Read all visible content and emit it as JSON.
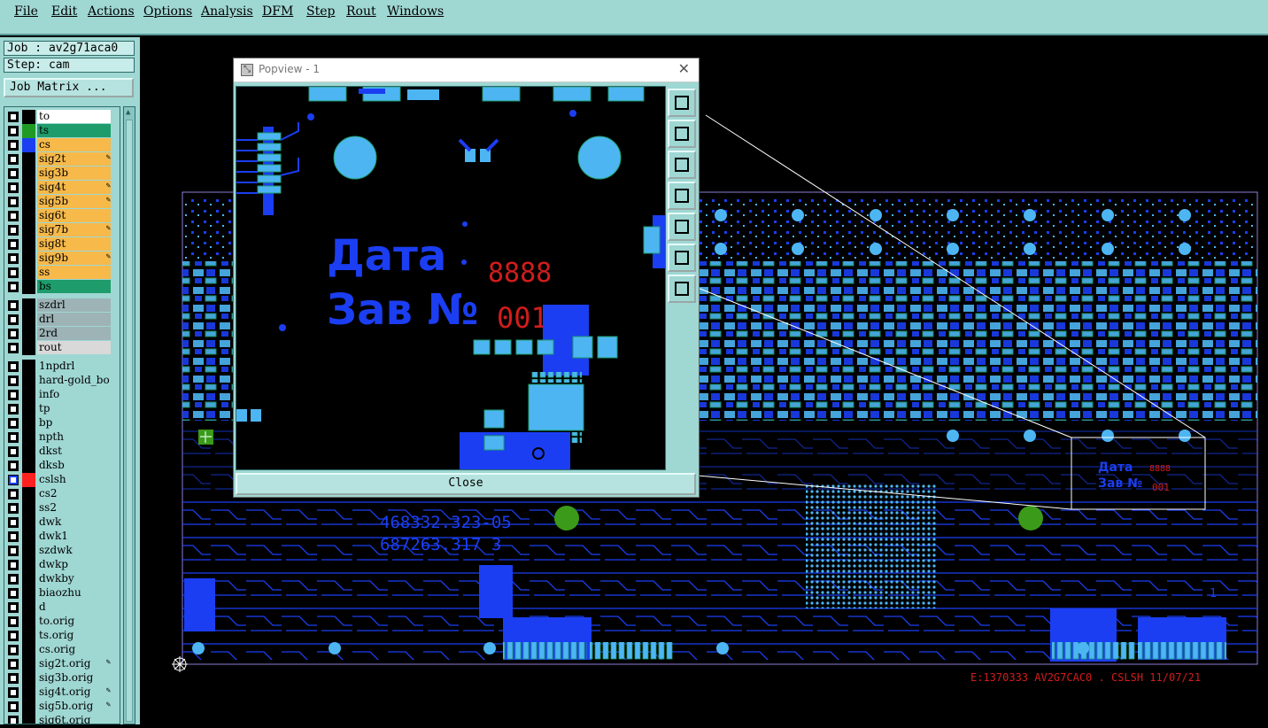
{
  "menu": [
    "File",
    "Edit",
    "Actions",
    "Options",
    "Analysis",
    "DFM",
    "Step",
    "Rout",
    "Windows"
  ],
  "job": {
    "label": "Job : av2g71aca0",
    "step": "Step: cam",
    "matrix_button": "Job Matrix ..."
  },
  "layers": [
    {
      "name": "to",
      "color": "#ffffff",
      "swatch": "#000000"
    },
    {
      "name": "ts",
      "color": "#1e9c6b",
      "swatch": "#1f9b25"
    },
    {
      "name": "cs",
      "color": "#f6b94a",
      "swatch": "#1b3ef2"
    },
    {
      "name": "sig2t",
      "color": "#f6b94a",
      "swatch": "#000000",
      "edit": true
    },
    {
      "name": "sig3b",
      "color": "#f6b94a",
      "swatch": "#000000"
    },
    {
      "name": "sig4t",
      "color": "#f6b94a",
      "swatch": "#000000",
      "edit": true
    },
    {
      "name": "sig5b",
      "color": "#f6b94a",
      "swatch": "#000000",
      "edit": true
    },
    {
      "name": "sig6t",
      "color": "#f6b94a",
      "swatch": "#000000"
    },
    {
      "name": "sig7b",
      "color": "#f6b94a",
      "swatch": "#000000",
      "edit": true
    },
    {
      "name": "sig8t",
      "color": "#f6b94a",
      "swatch": "#000000"
    },
    {
      "name": "sig9b",
      "color": "#f6b94a",
      "swatch": "#000000",
      "edit": true
    },
    {
      "name": "ss",
      "color": "#f6b94a",
      "swatch": "#000000"
    },
    {
      "name": "bs",
      "color": "#1e9c6b",
      "swatch": "#000000"
    },
    {
      "name": "szdrl",
      "color": "#9db3b6",
      "swatch": "#000000",
      "gap": true
    },
    {
      "name": "drl",
      "color": "#9db3b6",
      "swatch": "#000000"
    },
    {
      "name": "2rd",
      "color": "#9db3b6",
      "swatch": "#000000"
    },
    {
      "name": "rout",
      "color": "#d9d9d9",
      "swatch": "#000000"
    },
    {
      "name": "1npdrl",
      "color": "#9fd7d3",
      "swatch": "#000000",
      "gap": true
    },
    {
      "name": "hard-gold_bo",
      "color": "#9fd7d3",
      "swatch": "#000000"
    },
    {
      "name": "info",
      "color": "#9fd7d3",
      "swatch": "#000000"
    },
    {
      "name": "tp",
      "color": "#9fd7d3",
      "swatch": "#000000"
    },
    {
      "name": "bp",
      "color": "#9fd7d3",
      "swatch": "#000000"
    },
    {
      "name": "npth",
      "color": "#9fd7d3",
      "swatch": "#000000"
    },
    {
      "name": "dkst",
      "color": "#9fd7d3",
      "swatch": "#000000"
    },
    {
      "name": "dksb",
      "color": "#9fd7d3",
      "swatch": "#000000"
    },
    {
      "name": "cslsh",
      "color": "#9fd7d3",
      "swatch": "#ff2020",
      "active": true
    },
    {
      "name": "cs2",
      "color": "#9fd7d3",
      "swatch": "#000000"
    },
    {
      "name": "ss2",
      "color": "#9fd7d3",
      "swatch": "#000000"
    },
    {
      "name": "dwk",
      "color": "#9fd7d3",
      "swatch": "#000000"
    },
    {
      "name": "dwk1",
      "color": "#9fd7d3",
      "swatch": "#000000"
    },
    {
      "name": "szdwk",
      "color": "#9fd7d3",
      "swatch": "#000000"
    },
    {
      "name": "dwkp",
      "color": "#9fd7d3",
      "swatch": "#000000"
    },
    {
      "name": "dwkby",
      "color": "#9fd7d3",
      "swatch": "#000000"
    },
    {
      "name": "biaozhu",
      "color": "#9fd7d3",
      "swatch": "#000000"
    },
    {
      "name": "d",
      "color": "#9fd7d3",
      "swatch": "#000000"
    },
    {
      "name": "to.orig",
      "color": "#9fd7d3",
      "swatch": "#000000"
    },
    {
      "name": "ts.orig",
      "color": "#9fd7d3",
      "swatch": "#000000"
    },
    {
      "name": "cs.orig",
      "color": "#9fd7d3",
      "swatch": "#000000"
    },
    {
      "name": "sig2t.orig",
      "color": "#9fd7d3",
      "swatch": "#000000",
      "edit": true
    },
    {
      "name": "sig3b.orig",
      "color": "#9fd7d3",
      "swatch": "#000000"
    },
    {
      "name": "sig4t.orig",
      "color": "#9fd7d3",
      "swatch": "#000000",
      "edit": true
    },
    {
      "name": "sig5b.orig",
      "color": "#9fd7d3",
      "swatch": "#000000",
      "edit": true
    },
    {
      "name": "sig6t.orig",
      "color": "#9fd7d3",
      "swatch": "#000000"
    }
  ],
  "board": {
    "part_number_1": "468332.323-05",
    "part_number_2": "687263.317 3",
    "footer_text": "E:1370333 AV2G7CAC0 . CSLSH 11/07/21",
    "marker_1": "1",
    "mini_label_1": "Дата",
    "mini_label_2": "Зав №",
    "mini_digits": "8888",
    "mini_num": "001"
  },
  "popview": {
    "title": "Popview - 1",
    "label_date": "Дата",
    "label_serial": "Зав №",
    "digits": "8888",
    "number": "001",
    "close_button": "Close"
  },
  "popview_tools": [
    "zoom-window-icon",
    "pan-up-icon",
    "pan-down-icon",
    "pan-left-icon",
    "pan-right-icon",
    "zoom-in-icon",
    "zoom-out-icon"
  ],
  "colors": {
    "pad": "#4db6f2",
    "copper": "#1b3ef2",
    "text_red": "#d21c1c",
    "fiducial": "#3b9a1a",
    "panel": "#9fd7d3"
  }
}
